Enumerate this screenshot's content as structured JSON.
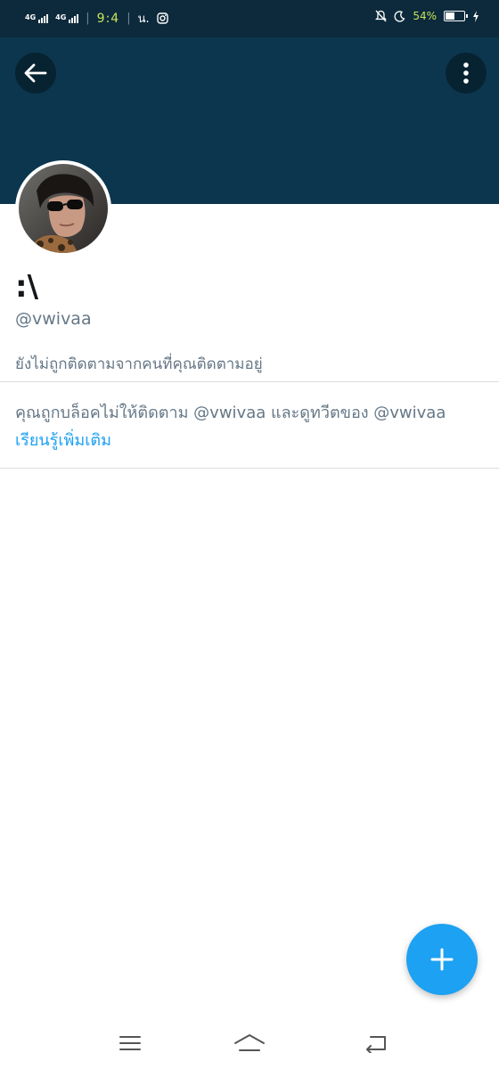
{
  "status_bar": {
    "network_1": "4G",
    "network_2": "4G",
    "time": "9:4",
    "carrier": "น.",
    "battery_percent": "54%",
    "battery_level": 0.54,
    "icons": [
      "instagram-icon",
      "bell-muted-icon",
      "moon-icon",
      "battery-icon",
      "charging-icon"
    ]
  },
  "header": {
    "banner_color": "#0c364e",
    "back_icon": "arrow-left-icon",
    "more_icon": "more-vertical-icon"
  },
  "profile": {
    "display_name": ":\\",
    "handle": "@vwivaa",
    "follow_note": "ยังไม่ถูกติดตามจากคนที่คุณติดตามอยู่"
  },
  "blocked": {
    "message": "คุณถูกบล็อคไม่ให้ติดตาม @vwivaa และดูทวีตของ @vwivaa",
    "learn_more": "เรียนรู้เพิ่มเติม"
  },
  "fab": {
    "icon": "plus-icon",
    "color": "#1da1f2"
  },
  "nav": {
    "icons": [
      "menu-icon",
      "home-icon",
      "back-icon"
    ]
  }
}
